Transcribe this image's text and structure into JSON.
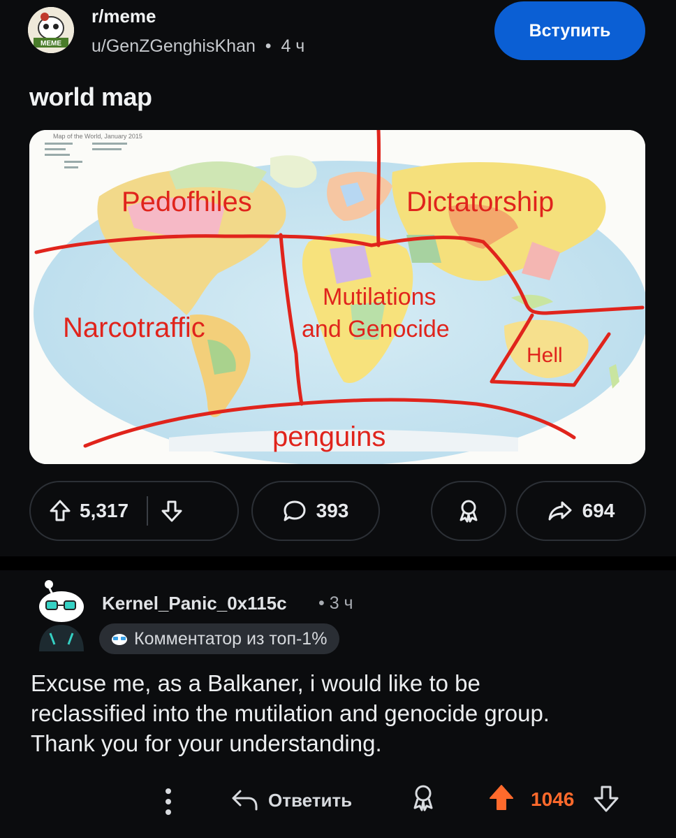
{
  "post": {
    "subreddit": "r/meme",
    "author": "u/GenZGenghisKhan",
    "time": "4 ч",
    "join_label": "Вступить",
    "title": "world map",
    "avatar_text": "MEME",
    "image": {
      "header_text": "Map of the World, January 2015",
      "regions": [
        "Pedofhiles",
        "Dictatorship",
        "Narcotraffic",
        "Mutilations",
        "and Genocide",
        "Hell",
        "penguins"
      ]
    },
    "upvotes": "5,317",
    "comments": "393",
    "shares": "694"
  },
  "comment": {
    "author": "Kernel_Panic_0x115c",
    "time": "3 ч",
    "flair": "Комментатор из топ-1%",
    "text_lines": [
      "Excuse me, as a Balkaner, i would like to be",
      "reclassified into the mutilation and genocide group.",
      "Thank you for your understanding."
    ],
    "reply_label": "Ответить",
    "score": "1046"
  },
  "colors": {
    "background": "#0b0c0e",
    "join_button": "#0b5fd4",
    "upvoted": "#ff6a2c",
    "map_lines": "#e0241c"
  }
}
